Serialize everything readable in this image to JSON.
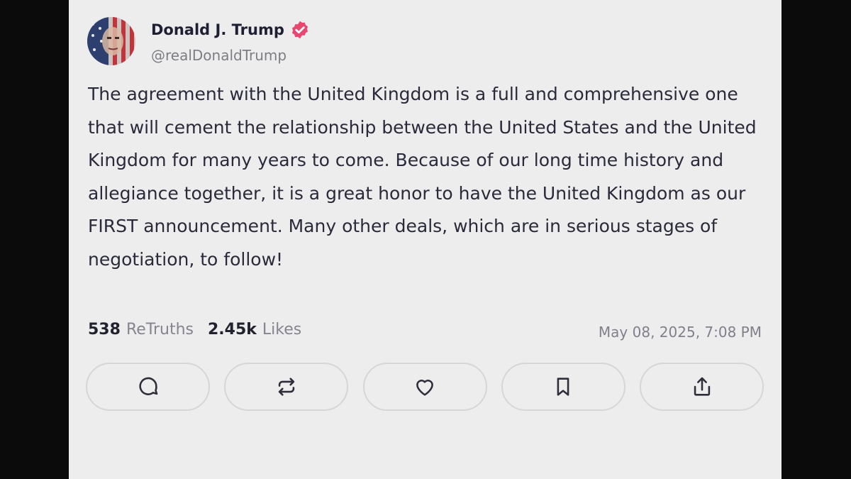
{
  "post": {
    "author_name": "Donald J. Trump",
    "author_handle": "@realDonaldTrump",
    "verified_badge_icon": "verified-badge-icon",
    "text": "The agreement with the United Kingdom is a full and comprehensive one that will cement the relationship between the United States and the United Kingdom for many years to come. Because of our long time history and allegiance together, it is a great honor to have the United Kingdom as our FIRST announcement. Many other deals, which are in serious stages of negotiation, to follow!",
    "retruths_count": "538",
    "retruths_label": "ReTruths",
    "likes_count": "2.45k",
    "likes_label": "Likes",
    "timestamp": "May 08, 2025, 7:08 PM"
  },
  "actions": [
    {
      "icon": "reply-icon"
    },
    {
      "icon": "retruth-icon"
    },
    {
      "icon": "heart-icon"
    },
    {
      "icon": "bookmark-icon"
    },
    {
      "icon": "share-icon"
    }
  ],
  "colors": {
    "background": "#ededed",
    "letterbox": "#0b0b0b",
    "verified_badge": "#e8476f",
    "text_primary": "#2a2a3a",
    "text_secondary": "#80808a"
  }
}
